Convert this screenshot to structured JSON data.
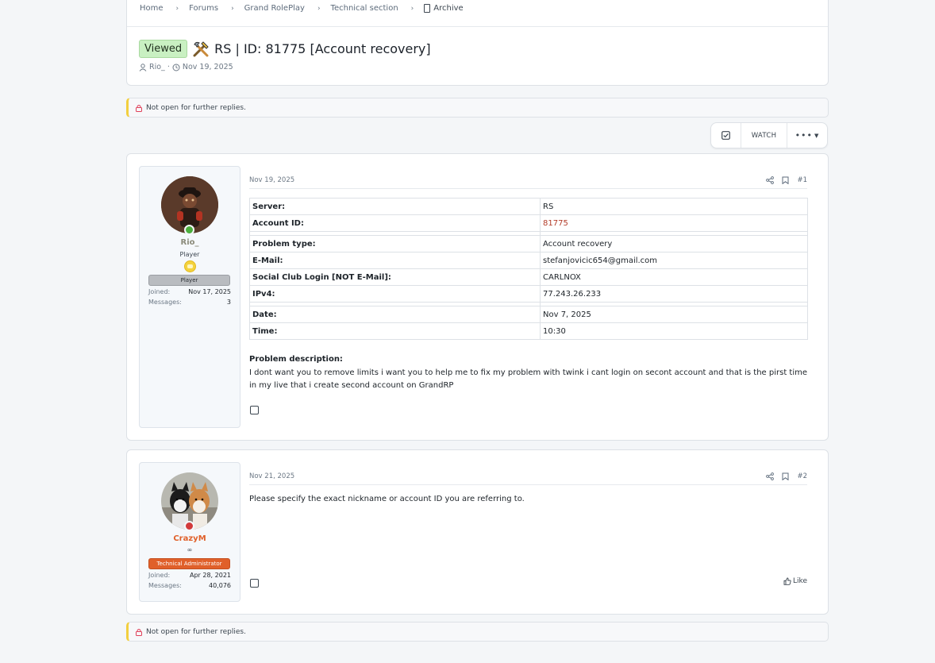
{
  "breadcrumb": {
    "items": [
      "Home",
      "Forums",
      "Grand RolePlay",
      "Technical section"
    ],
    "current": "Archive"
  },
  "thread": {
    "badge": "Viewed",
    "title": "RS | ID: 81775 [Account recovery]",
    "author": "Rio_",
    "date": "Nov 19, 2025"
  },
  "notice": {
    "text": "Not open for further replies."
  },
  "toolbar": {
    "watch_label": "WATCH",
    "more_label": "•••"
  },
  "posts": [
    {
      "date": "Nov 19, 2025",
      "number": "#1",
      "user": {
        "name": "Rio_",
        "title": "Player",
        "banner": "Player",
        "joined_label": "Joined:",
        "joined": "Nov 17, 2025",
        "messages_label": "Messages:",
        "messages": "3",
        "name_color": "#8b8b7a",
        "status_color": "#4caf3e"
      },
      "fields": [
        {
          "key": "Server:",
          "value": "RS"
        },
        {
          "key": "Account ID:",
          "value": "81775"
        },
        {
          "key": "Problem type:",
          "value": "Account recovery"
        },
        {
          "key": "E-Mail:",
          "value": "stefanjovicic654@gmail.com"
        },
        {
          "key": "Social Club Login [NOT E-Mail]:",
          "value": "CARLNOX"
        },
        {
          "key": "IPv4:",
          "value": "77.243.26.233"
        },
        {
          "key": "Date:",
          "value": "Nov 7, 2025"
        },
        {
          "key": "Time:",
          "value": "10:30"
        }
      ],
      "problem_label": "Problem description:",
      "problem_text": "I dont want you to remove limits i want you to help me to fix my problem with twink i cant login on secont account and that is the pirst time in my live that i create second account on GrandRP"
    },
    {
      "date": "Nov 21, 2025",
      "number": "#2",
      "user": {
        "name": "CrazyM",
        "title": "∞",
        "banner": "Technical Administrator",
        "joined_label": "Joined:",
        "joined": "Apr 28, 2021",
        "messages_label": "Messages:",
        "messages": "40,076",
        "name_color": "#e0602a",
        "status_color": "#d23a3a"
      },
      "text": "Please specify the exact nickname or account ID you are referring to.",
      "like_label": "Like"
    }
  ]
}
